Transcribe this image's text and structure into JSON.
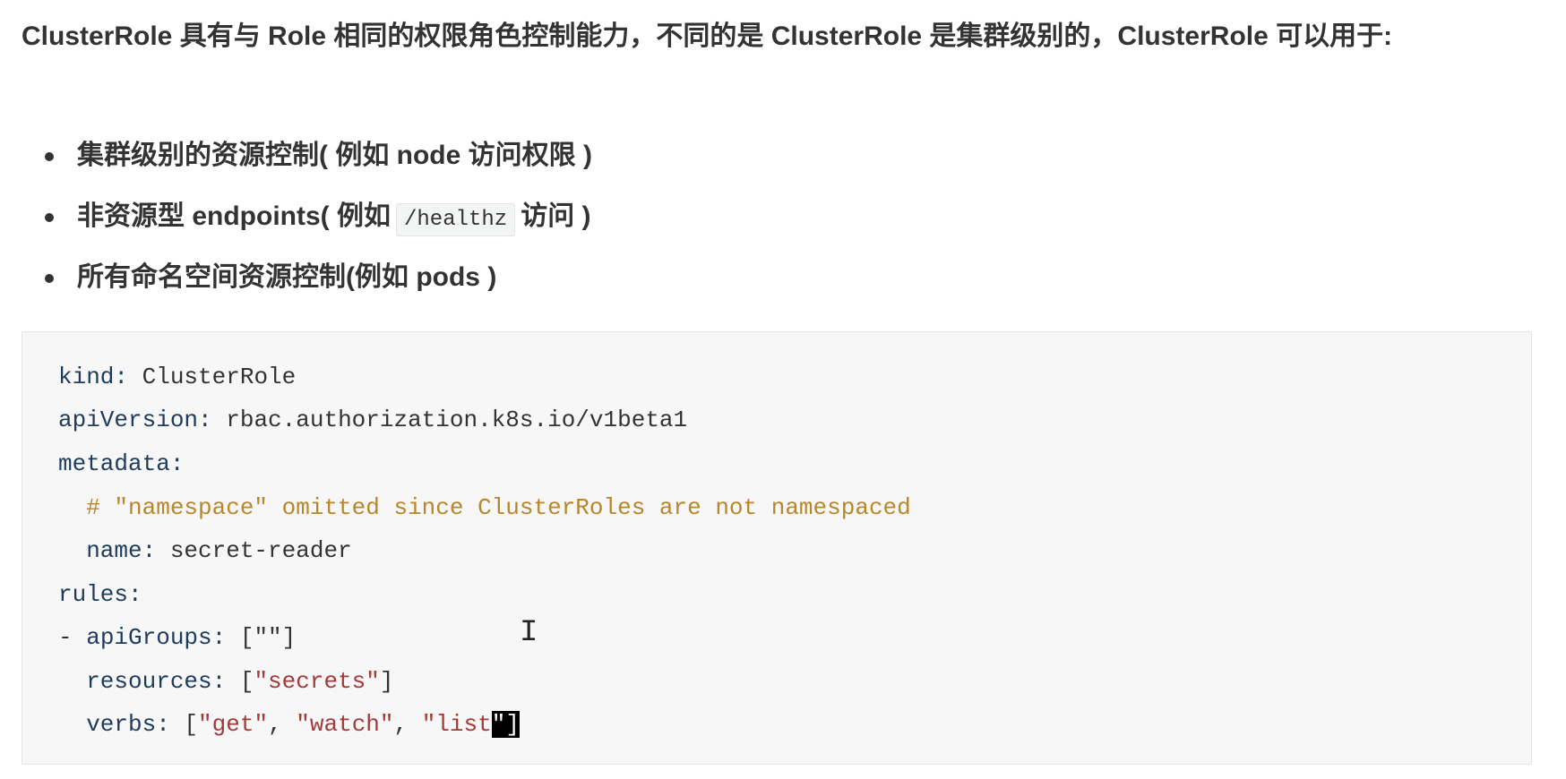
{
  "intro": "ClusterRole 具有与 Role  相同的权限角色控制能力，不同的是 ClusterRole 是集群级别的，ClusterRole 可以用于:",
  "bullets": [
    {
      "text": "集群级别的资源控制( 例如 node 访问权限 )"
    },
    {
      "before": "非资源型 endpoints( 例如",
      "code": "/healthz",
      "after": "访问 )"
    },
    {
      "text": "所有命名空间资源控制(例如 pods )"
    }
  ],
  "code": {
    "l1k": "kind:",
    "l1v": " ClusterRole",
    "l2k": "apiVersion:",
    "l2v": " rbac.authorization.k8s.io/v1beta1",
    "l3k": "metadata:",
    "l4c": "  # \"namespace\" omitted since ClusterRoles are not namespaced",
    "l5k": "  name:",
    "l5v": " secret-reader",
    "l6k": "rules:",
    "l7a": "- ",
    "l7k": "apiGroups:",
    "l7v": " [\"\"]",
    "l8k": "  resources:",
    "l8v1": " [",
    "l8s": "\"secrets\"",
    "l8v2": "]",
    "l9k": "  verbs:",
    "l9v1": " [",
    "l9s1": "\"get\"",
    "l9c1": ", ",
    "l9s2": "\"watch\"",
    "l9c2": ", ",
    "l9s3": "\"list",
    "l9sel": "\"",
    "l9v2": "]"
  },
  "cursor_glyph": "I"
}
